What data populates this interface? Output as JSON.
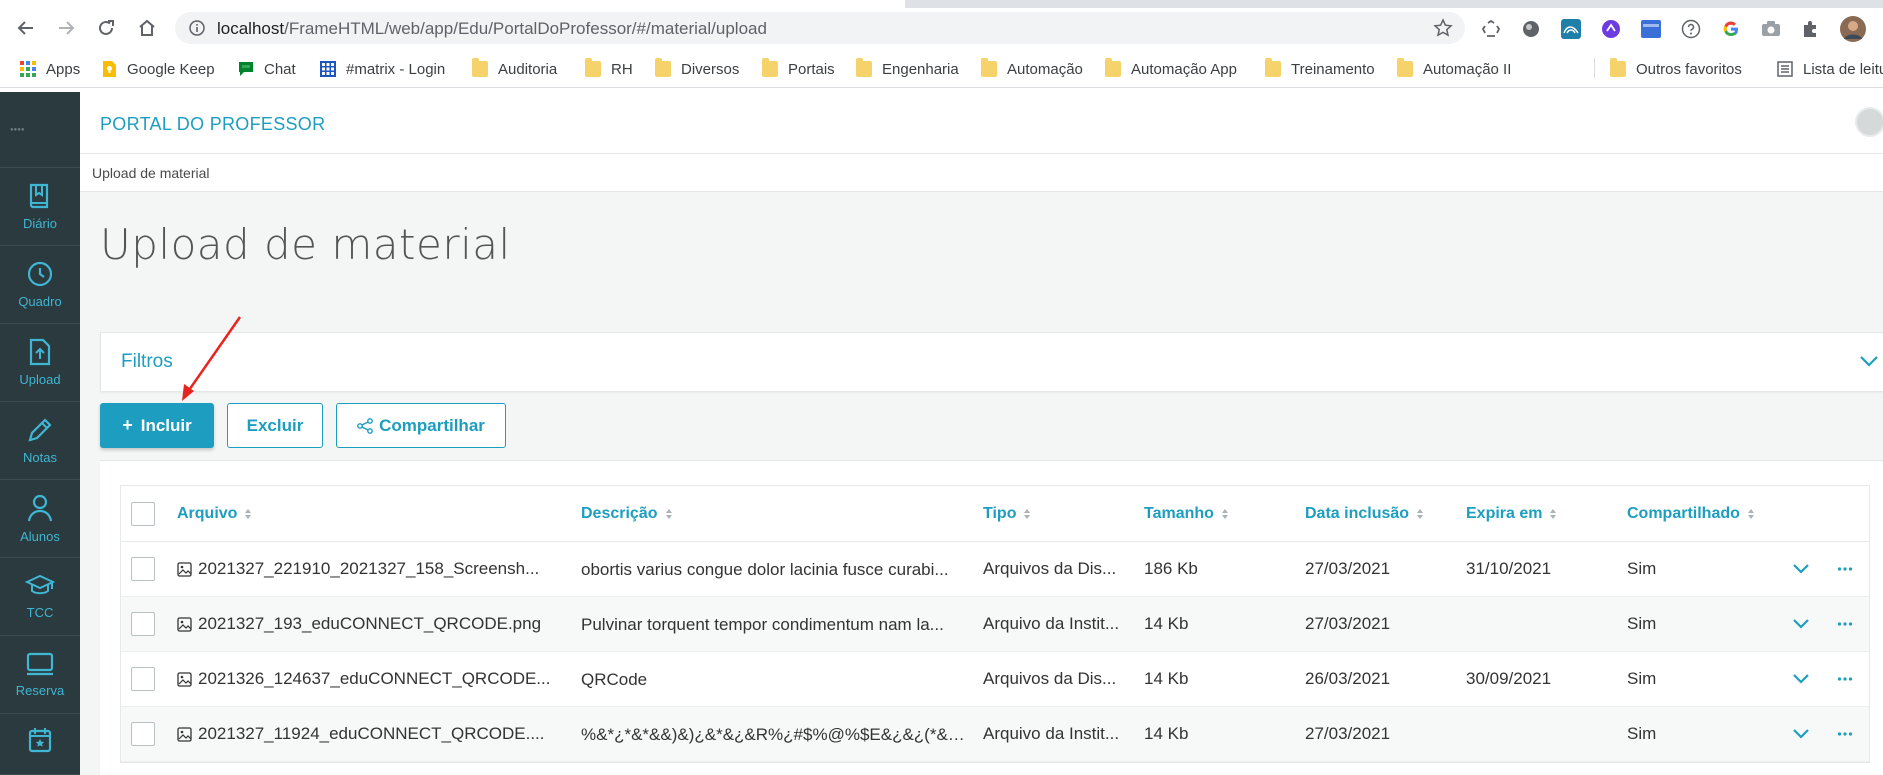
{
  "browser": {
    "url_host": "localhost",
    "url_path": "/FrameHTML/web/app/Edu/PortalDoProfessor/#/material/upload",
    "bookmarks": [
      {
        "label": "Apps",
        "icon": "apps-grid-icon"
      },
      {
        "label": "Google Keep",
        "icon": "keep-icon"
      },
      {
        "label": "Chat",
        "icon": "chat-icon"
      },
      {
        "label": "#matrix - Login",
        "icon": "matrix-icon"
      },
      {
        "label": "Auditoria",
        "icon": "folder-icon"
      },
      {
        "label": "RH",
        "icon": "folder-icon"
      },
      {
        "label": "Diversos",
        "icon": "folder-icon"
      },
      {
        "label": "Portais",
        "icon": "folder-icon"
      },
      {
        "label": "Engenharia",
        "icon": "folder-icon"
      },
      {
        "label": "Automação",
        "icon": "folder-icon"
      },
      {
        "label": "Automação App",
        "icon": "folder-icon"
      },
      {
        "label": "Treinamento",
        "icon": "folder-icon"
      },
      {
        "label": "Automação II",
        "icon": "folder-icon"
      }
    ],
    "other_bookmarks": "Outros favoritos",
    "reading_list": "Lista de leitura"
  },
  "sidebar": {
    "items": [
      {
        "label": "Diário",
        "icon": "book-icon"
      },
      {
        "label": "Quadro",
        "icon": "clock-icon"
      },
      {
        "label": "Upload",
        "icon": "upload-file-icon"
      },
      {
        "label": "Notas",
        "icon": "pencil-icon"
      },
      {
        "label": "Alunos",
        "icon": "user-icon"
      },
      {
        "label": "TCC",
        "icon": "graduation-cap-icon"
      },
      {
        "label": "Reserva",
        "icon": "monitor-icon"
      },
      {
        "label": "",
        "icon": "calendar-star-icon"
      }
    ]
  },
  "header": {
    "title": "PORTAL DO PROFESSOR"
  },
  "breadcrumb": {
    "current": "Upload de material"
  },
  "page": {
    "title": "Upload de material"
  },
  "filters": {
    "label": "Filtros"
  },
  "actions": {
    "incluir": "Incluir",
    "excluir": "Excluir",
    "compartilhar": "Compartilhar"
  },
  "table": {
    "headers": {
      "arquivo": "Arquivo",
      "descricao": "Descrição",
      "tipo": "Tipo",
      "tamanho": "Tamanho",
      "data_inclusao": "Data inclusão",
      "expira_em": "Expira em",
      "compartilhado": "Compartilhado"
    },
    "rows": [
      {
        "arquivo": "2021327_221910_2021327_158_Screensh...",
        "descricao": "obortis varius congue dolor lacinia fusce curabi...",
        "tipo": "Arquivos da Dis...",
        "tamanho": "186 Kb",
        "data_inclusao": "27/03/2021",
        "expira_em": "31/10/2021",
        "compartilhado": "Sim"
      },
      {
        "arquivo": "2021327_193_eduCONNECT_QRCODE.png",
        "descricao": "Pulvinar torquent tempor condimentum nam la...",
        "tipo": "Arquivo da Instit...",
        "tamanho": "14 Kb",
        "data_inclusao": "27/03/2021",
        "expira_em": "",
        "compartilhado": "Sim"
      },
      {
        "arquivo": "2021326_124637_eduCONNECT_QRCODE...",
        "descricao": "QRCode",
        "tipo": "Arquivos da Dis...",
        "tamanho": "14 Kb",
        "data_inclusao": "26/03/2021",
        "expira_em": "30/09/2021",
        "compartilhado": "Sim"
      },
      {
        "arquivo": "2021327_11924_eduCONNECT_QRCODE....",
        "descricao": "%&*¿*&*&&)&)¿&*&¿&R%¿#$%@%$E&¿&¿(*&(...",
        "tipo": "Arquivo da Instit...",
        "tamanho": "14 Kb",
        "data_inclusao": "27/03/2021",
        "expira_em": "",
        "compartilhado": "Sim"
      }
    ]
  },
  "colors": {
    "accent": "#1d9ec0",
    "sidebar_bg": "#2b3a3e",
    "annotation_arrow": "#e8241f"
  }
}
